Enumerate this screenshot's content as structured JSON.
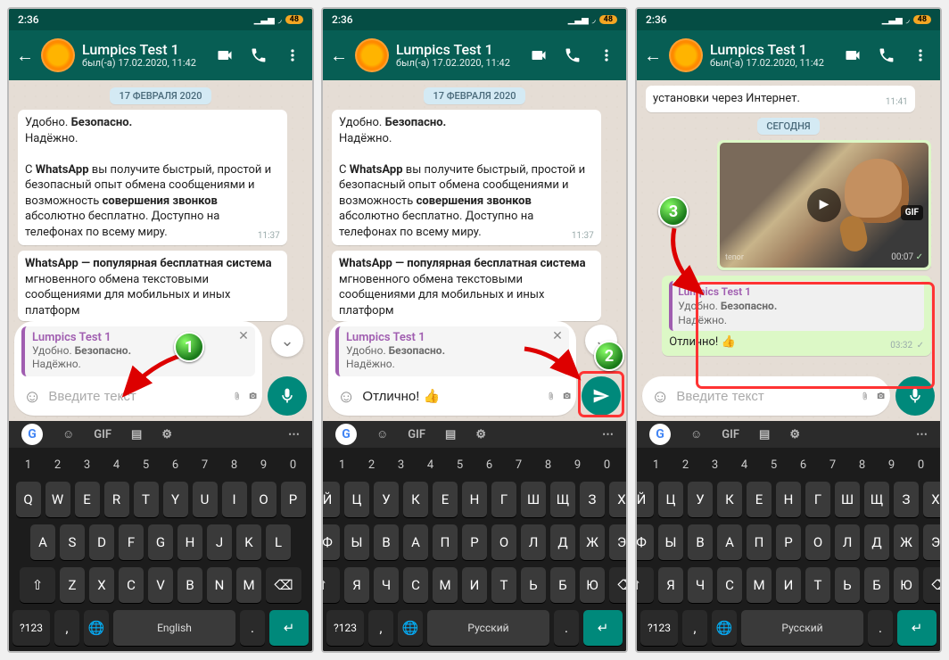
{
  "status": {
    "time": "2:36",
    "battery": "48"
  },
  "header": {
    "title": "Lumpics Test 1",
    "subtitle": "был(-а) 17.02.2020, 11:42"
  },
  "date_chip": "17 ФЕВРАЛЯ 2020",
  "msg1": {
    "line1_a": "Удобно. ",
    "line1_b": "Безопасно.",
    "line2": "Надёжно.",
    "para2_a": "С ",
    "para2_b": "WhatsApp",
    "para2_c": " вы получите быстрый, простой и безопасный опыт обмена сообщениями и возможность ",
    "para2_d": "совершения звонков",
    "para2_e": " абсолютно бесплатно. Доступно на телефонах по всему миру.",
    "time": "11:37",
    "para3_a": "WhatsApp — популярная бесплатная система",
    "para3_b": " мгновенного обмена текстовыми сообщениями для мобильных и иных платформ"
  },
  "reply": {
    "sender": "Lumpics Test 1",
    "content_a": "Удобно. ",
    "content_b": "Безопасно.",
    "content_c": "Надёжно."
  },
  "input": {
    "placeholder": "Введите текст",
    "typed": "Отлично! 👍"
  },
  "phone3": {
    "prev_msg": "установки через Интернет.",
    "prev_time": "11:41",
    "today": "СЕГОДНЯ",
    "gif_label": "GIF",
    "gif_wm": "tenor",
    "gif_time": "00:07",
    "sent_text": "Отлично! 👍",
    "sent_time": "03:32"
  },
  "keyboard": {
    "sugg": {
      "gif": "GIF"
    },
    "nums": [
      "1",
      "2",
      "3",
      "4",
      "5",
      "6",
      "7",
      "8",
      "9",
      "0"
    ],
    "en": {
      "r1": [
        "Q",
        "W",
        "E",
        "R",
        "T",
        "Y",
        "U",
        "I",
        "O",
        "P"
      ],
      "r2": [
        "A",
        "S",
        "D",
        "F",
        "G",
        "H",
        "J",
        "K",
        "L"
      ],
      "r3": [
        "Z",
        "X",
        "C",
        "V",
        "B",
        "N",
        "M"
      ],
      "lang": "English"
    },
    "ru": {
      "r1": [
        "Й",
        "Ц",
        "У",
        "К",
        "Е",
        "Н",
        "Г",
        "Ш",
        "Щ",
        "З",
        "Х"
      ],
      "r2": [
        "Ф",
        "Ы",
        "В",
        "А",
        "П",
        "Р",
        "О",
        "Л",
        "Д",
        "Ж",
        "Э"
      ],
      "r3": [
        "Я",
        "Ч",
        "С",
        "М",
        "И",
        "Т",
        "Ь",
        "Б",
        "Ю"
      ],
      "lang": "Русский"
    },
    "sym": "?123"
  },
  "annotations": {
    "n1": "1",
    "n2": "2",
    "n3": "3"
  }
}
